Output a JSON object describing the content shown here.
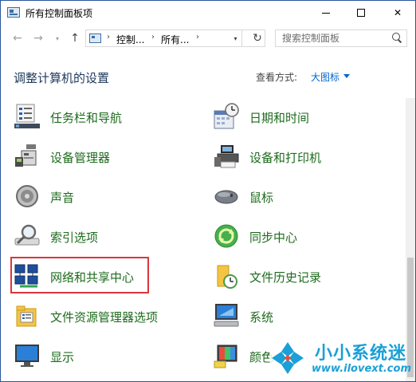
{
  "window": {
    "title": "所有控制面板项",
    "buttons": {
      "minimize": "minimize-icon",
      "maximize": "maximize-icon",
      "close": "✕"
    }
  },
  "nav": {
    "back": "←",
    "forward": "→",
    "recent": "▾",
    "up": "↑",
    "breadcrumb": [
      "控制...",
      "所有..."
    ],
    "separator": "›",
    "refresh": "↻",
    "search_placeholder": "搜索控制面板"
  },
  "header": {
    "title": "调整计算机的设置",
    "view_by_label": "查看方式:",
    "view_by_value": "大图标"
  },
  "items": {
    "left": [
      "任务栏和导航",
      "设备管理器",
      "声音",
      "索引选项",
      "网络和共享中心",
      "文件资源管理器选项",
      "显示"
    ],
    "right": [
      "日期和时间",
      "设备和打印机",
      "鼠标",
      "同步中心",
      "文件历史记录",
      "系统",
      "颜色"
    ]
  },
  "highlighted_item": "网络和共享中心",
  "watermark": {
    "title": "小小系统迷",
    "url": "www.ilovext.com"
  },
  "colors": {
    "link_green": "#1e6b1e",
    "link_blue": "#0066cc",
    "title_blue": "#1e395b",
    "highlight_red": "#d9363e",
    "watermark_blue": "#1aa0d6"
  }
}
